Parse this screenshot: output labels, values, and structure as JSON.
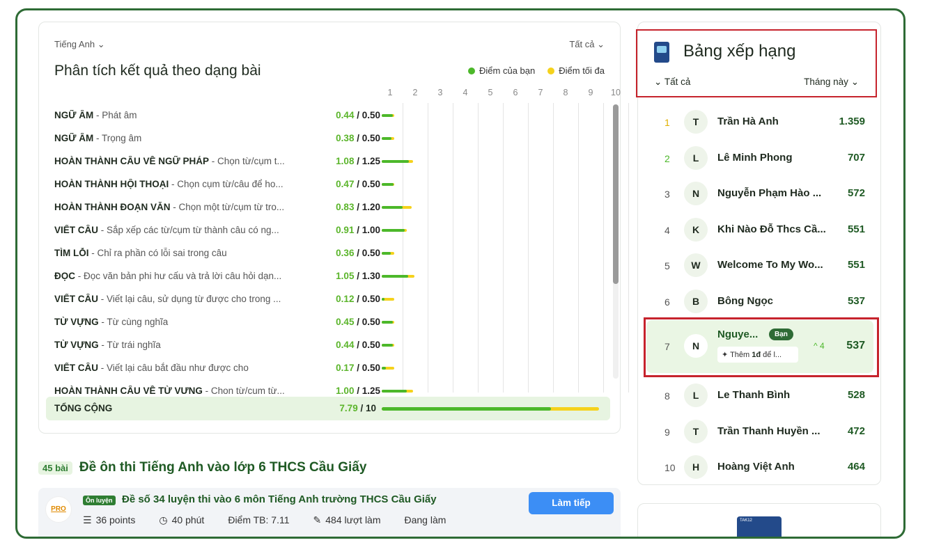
{
  "analysis": {
    "subject": "Tiếng Anh",
    "filter": "Tất cả",
    "title": "Phân tích kết quả theo dạng bài",
    "legend_mine": "Điểm của bạn",
    "legend_max": "Điểm tối đa",
    "colors": {
      "mine": "#4cb82a",
      "max": "#f5d21c"
    },
    "scale": [
      "1",
      "2",
      "3",
      "4",
      "5",
      "6",
      "7",
      "8",
      "9",
      "10"
    ],
    "rows": [
      {
        "type": "NGỮ ÂM",
        "desc": "Phát âm",
        "mine": "0.44",
        "max": "0.50"
      },
      {
        "type": "NGỮ ÂM",
        "desc": "Trọng âm",
        "mine": "0.38",
        "max": "0.50"
      },
      {
        "type": "HOÀN THÀNH CÂU VỀ NGỮ PHÁP",
        "desc": "Chọn từ/cụm t...",
        "mine": "1.08",
        "max": "1.25"
      },
      {
        "type": "HOÀN THÀNH HỘI THOẠI",
        "desc": "Chọn cụm từ/câu để ho...",
        "mine": "0.47",
        "max": "0.50"
      },
      {
        "type": "HOÀN THÀNH ĐOẠN VĂN",
        "desc": "Chọn một từ/cụm từ tro...",
        "mine": "0.83",
        "max": "1.20"
      },
      {
        "type": "VIẾT CÂU",
        "desc": "Sắp xếp các từ/cụm từ thành câu có ng...",
        "mine": "0.91",
        "max": "1.00"
      },
      {
        "type": "TÌM LỖI",
        "desc": "Chỉ ra phần có lỗi sai trong câu",
        "mine": "0.36",
        "max": "0.50"
      },
      {
        "type": "ĐỌC",
        "desc": "Đọc văn bản phi hư cấu và trả lời câu hỏi dạn...",
        "mine": "1.05",
        "max": "1.30"
      },
      {
        "type": "VIẾT CÂU",
        "desc": "Viết lại câu, sử dụng từ được cho trong ...",
        "mine": "0.12",
        "max": "0.50"
      },
      {
        "type": "TỪ VỰNG",
        "desc": "Từ cùng nghĩa",
        "mine": "0.45",
        "max": "0.50"
      },
      {
        "type": "TỪ VỰNG",
        "desc": "Từ trái nghĩa",
        "mine": "0.44",
        "max": "0.50"
      },
      {
        "type": "VIẾT CÂU",
        "desc": "Viết lại câu bắt đầu như được cho",
        "mine": "0.17",
        "max": "0.50"
      },
      {
        "type": "HOÀN THÀNH CÂU VỀ TỪ VỰNG",
        "desc": "Chọn từ/cụm từ...",
        "mine": "1.00",
        "max": "1.25"
      }
    ],
    "total_label": "TỔNG CỘNG",
    "total_mine": "7.79",
    "total_max": "10"
  },
  "collection": {
    "count": "45 bài",
    "title": "Đề ôn thi Tiếng Anh vào lớp 6 THCS Cầu Giấy"
  },
  "test": {
    "logo": "PRO",
    "tag": "Ôn luyện",
    "title": "Đề số 34 luyện thi vào 6 môn Tiếng Anh trường THCS Cầu Giấy",
    "points": "36 points",
    "duration": "40 phút",
    "avg": "Điểm TB: 7.11",
    "attempts": "484 lượt làm",
    "status": "Đang làm",
    "button": "Làm tiếp"
  },
  "ranking": {
    "title": "Bảng xếp hạng",
    "filter": "Tất cả",
    "period": "Tháng này",
    "entries": [
      {
        "rank": "1",
        "initial": "T",
        "name": "Trần Hà Anh",
        "points": "1.359"
      },
      {
        "rank": "2",
        "initial": "L",
        "name": "Lê Minh Phong",
        "points": "707"
      },
      {
        "rank": "3",
        "initial": "N",
        "name": "Nguyễn Phạm Hào ...",
        "points": "572"
      },
      {
        "rank": "4",
        "initial": "K",
        "name": "Khi Nào Đỗ Thcs Cầ...",
        "points": "551"
      },
      {
        "rank": "5",
        "initial": "W",
        "name": "Welcome To My Wo...",
        "points": "551"
      },
      {
        "rank": "6",
        "initial": "B",
        "name": "Bông Ngọc",
        "points": "537"
      },
      {
        "rank": "8",
        "initial": "L",
        "name": "Le Thanh Bình",
        "points": "528"
      },
      {
        "rank": "9",
        "initial": "T",
        "name": "Trần Thanh Huyền ...",
        "points": "472"
      },
      {
        "rank": "10",
        "initial": "H",
        "name": "Hoàng Việt Anh",
        "points": "464"
      }
    ],
    "me": {
      "rank": "7",
      "initial": "N",
      "name": "Nguye...",
      "badge": "Bạn",
      "hint_prefix": "✦ Thêm ",
      "hint_value": "1đ",
      "hint_suffix": " để l...",
      "change": "^ 4",
      "points": "537"
    }
  },
  "promo": {
    "label": "TAK12"
  }
}
